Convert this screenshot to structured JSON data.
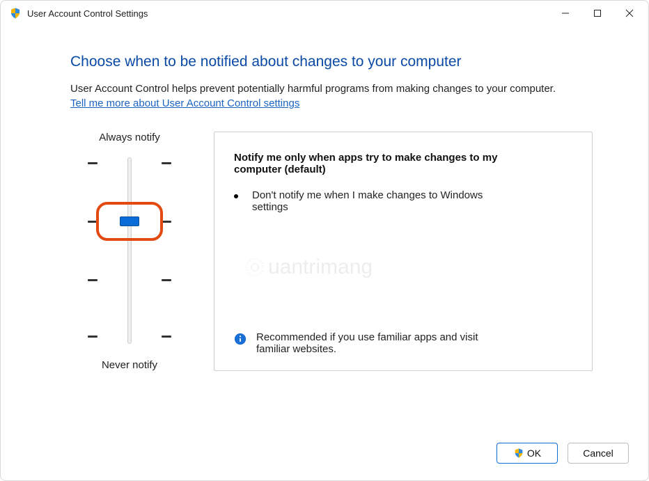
{
  "window": {
    "title": "User Account Control Settings"
  },
  "main": {
    "heading": "Choose when to be notified about changes to your computer",
    "description": "User Account Control helps prevent potentially harmful programs from making changes to your computer.",
    "link": "Tell me more about User Account Control settings"
  },
  "slider": {
    "top_label": "Always notify",
    "bottom_label": "Never notify",
    "levels": 4,
    "selected_index": 1
  },
  "panel": {
    "title": "Notify me only when apps try to make changes to my computer (default)",
    "bullet": "Don't notify me when I make changes to Windows settings",
    "recommendation": "Recommended if you use familiar apps and visit familiar websites."
  },
  "buttons": {
    "ok": "OK",
    "cancel": "Cancel"
  },
  "watermark": "uantrimang"
}
